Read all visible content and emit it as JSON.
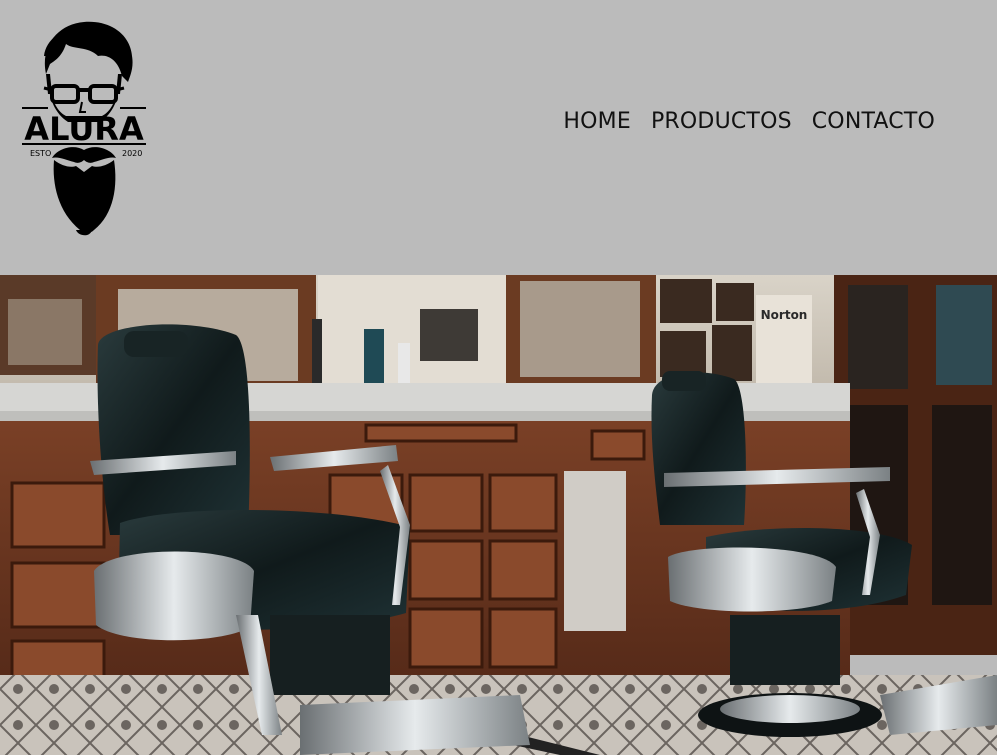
{
  "brand": {
    "name": "ALURA",
    "established_label": "ESTO",
    "established_year": "2020",
    "logo_icon": "bearded-man-glasses-icon"
  },
  "nav": {
    "items": [
      {
        "label": "HOME"
      },
      {
        "label": "PRODUCTOS"
      },
      {
        "label": "CONTACTO"
      }
    ]
  },
  "hero": {
    "poster_text": "Norton"
  },
  "colors": {
    "header_background": "#bbbbbb",
    "nav_text": "#111111",
    "logo": "#000000"
  }
}
